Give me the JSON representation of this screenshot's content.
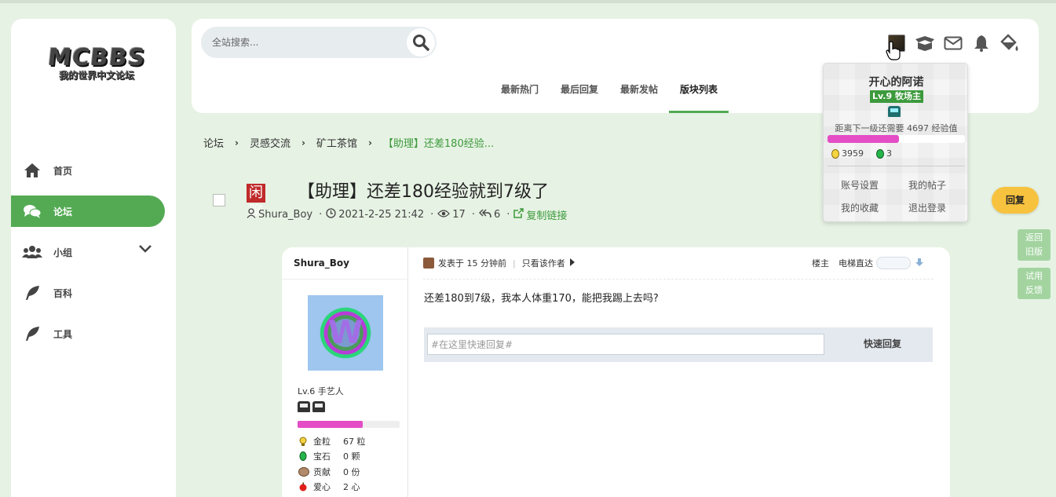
{
  "logo": {
    "big": "MCBBS",
    "small": "我的世界中文论坛"
  },
  "sidebar": {
    "items": [
      {
        "label": "首页",
        "icon": "home-icon"
      },
      {
        "label": "论坛",
        "icon": "chat-icon"
      },
      {
        "label": "小组",
        "icon": "users-icon"
      },
      {
        "label": "百科",
        "icon": "feather-icon"
      },
      {
        "label": "工具",
        "icon": "feather-icon"
      }
    ]
  },
  "search": {
    "placeholder": "全站搜索..."
  },
  "header": {
    "tabs": [
      "最新热门",
      "最后回复",
      "最新发帖",
      "版块列表"
    ],
    "active_tab": "版块列表",
    "icons": [
      "avatar",
      "box-icon",
      "mail-icon",
      "bell-icon",
      "paint-bucket-icon"
    ]
  },
  "breadcrumb": [
    "论坛",
    "灵感交流",
    "矿工茶馆",
    "【助理】还差180经验..."
  ],
  "thread": {
    "badge": "闲聊",
    "title": "【助理】还差180经验就到7级了",
    "author": "Shura_Boy",
    "date": "2021-2-25 21:42",
    "views": "17",
    "replies": "6",
    "copy_link": "复制链接"
  },
  "post": {
    "author": "Shura_Boy",
    "posted": "发表于 15 分钟前",
    "only_author": "只看该作者",
    "floor": "楼主",
    "elevator": "电梯直达",
    "body": "还差180到7级，我本人体重170，能把我踢上去吗?",
    "reply_placeholder": "#在这里快速回复#",
    "quick_reply": "快速回复",
    "level": "Lv.6 手艺人",
    "exp_progress": 0.64,
    "stats": [
      {
        "label": "金粒",
        "value": "67 粒"
      },
      {
        "label": "宝石",
        "value": "0 颗"
      },
      {
        "label": "贡献",
        "value": "0 份"
      },
      {
        "label": "爱心",
        "value": "2 心"
      }
    ]
  },
  "popup": {
    "name": "开心的阿诺",
    "level": "Lv.9 牧场主",
    "next_level": "距离下一级还需要 4697 经验值",
    "exp_progress": 0.52,
    "gold": "3959",
    "gem": "3",
    "links": [
      "账号设置",
      "我的帖子",
      "我的收藏",
      "退出登录"
    ]
  },
  "float": {
    "reply": "回复",
    "old_version": [
      "返回",
      "旧版"
    ],
    "feedback": [
      "试用",
      "反馈"
    ]
  },
  "colors": {
    "accent": "#53aa53",
    "badge": "#c02a2a",
    "exp_bar": "#e44dc5",
    "reply": "#f7c23e"
  }
}
